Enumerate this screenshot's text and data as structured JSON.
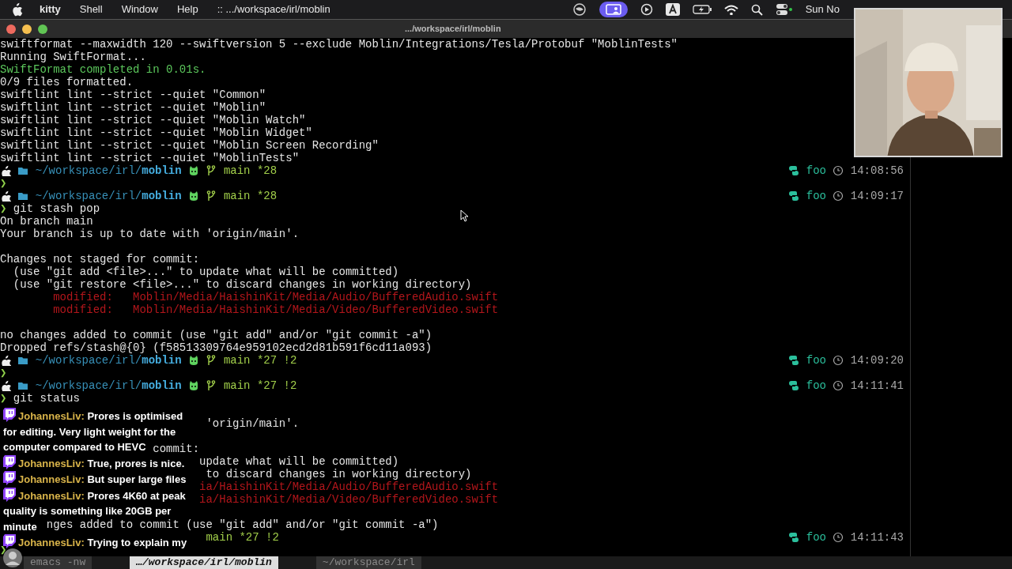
{
  "menu_bar": {
    "app": "kitty",
    "items": [
      "Shell",
      "Window",
      "Help"
    ],
    "window_label": ":: .../workspace/irl/moblin",
    "clock": "Sun No"
  },
  "window": {
    "title": ".../workspace/irl/moblin"
  },
  "terminal_lines": [
    {
      "kind": "output",
      "text": "swiftformat --maxwidth 120 --swiftversion 5 --exclude Moblin/Integrations/Tesla/Protobuf \"MoblinTests\""
    },
    {
      "kind": "output",
      "text": "Running SwiftFormat..."
    },
    {
      "kind": "success_output",
      "text": "SwiftFormat completed in 0.01s."
    },
    {
      "kind": "output",
      "text": "0/9 files formatted."
    },
    {
      "kind": "output",
      "text": "swiftlint lint --strict --quiet \"Common\""
    },
    {
      "kind": "output",
      "text": "swiftlint lint --strict --quiet \"Moblin\""
    },
    {
      "kind": "output",
      "text": "swiftlint lint --strict --quiet \"Moblin Watch\""
    },
    {
      "kind": "output",
      "text": "swiftlint lint --strict --quiet \"Moblin Widget\""
    },
    {
      "kind": "output",
      "text": "swiftlint lint --strict --quiet \"Moblin Screen Recording\""
    },
    {
      "kind": "output",
      "text": "swiftlint lint --strict --quiet \"MoblinTests\""
    },
    {
      "kind": "prompt",
      "path": "~/workspace/irl/",
      "dir": "moblin",
      "branch": "main *28",
      "env": "foo",
      "time": "14:08:56"
    },
    {
      "kind": "input",
      "symbol": "❯"
    },
    {
      "kind": "prompt",
      "path": "~/workspace/irl/",
      "dir": "moblin",
      "branch": "main *28",
      "env": "foo",
      "time": "14:09:17"
    },
    {
      "kind": "input",
      "symbol": "❯",
      "command": "git stash pop"
    },
    {
      "kind": "output",
      "text": "On branch main"
    },
    {
      "kind": "output",
      "text": "Your branch is up to date with 'origin/main'."
    },
    {
      "kind": "blank"
    },
    {
      "kind": "output",
      "text": "Changes not staged for commit:"
    },
    {
      "kind": "output",
      "text": "  (use \"git add <file>...\" to update what will be committed)"
    },
    {
      "kind": "output",
      "text": "  (use \"git restore <file>...\" to discard changes in working directory)"
    },
    {
      "kind": "error_output",
      "text": "        modified:   Moblin/Media/HaishinKit/Media/Audio/BufferedAudio.swift"
    },
    {
      "kind": "error_output",
      "text": "        modified:   Moblin/Media/HaishinKit/Media/Video/BufferedVideo.swift"
    },
    {
      "kind": "blank"
    },
    {
      "kind": "output",
      "text": "no changes added to commit (use \"git add\" and/or \"git commit -a\")"
    },
    {
      "kind": "output",
      "text": "Dropped refs/stash@{0} (f58513309764e959102ecd2d81b591f6cd11a093)"
    },
    {
      "kind": "prompt",
      "path": "~/workspace/irl/",
      "dir": "moblin",
      "branch": "main *27 !2",
      "env": "foo",
      "time": "14:09:20"
    },
    {
      "kind": "input",
      "symbol": "❯"
    },
    {
      "kind": "prompt",
      "path": "~/workspace/irl/",
      "dir": "moblin",
      "branch": "main *27 !2",
      "env": "foo",
      "time": "14:11:41"
    },
    {
      "kind": "input",
      "symbol": "❯",
      "command": "git status"
    },
    {
      "kind": "blank"
    },
    {
      "kind": "output",
      "text": "                               'origin/main'."
    },
    {
      "kind": "blank"
    },
    {
      "kind": "output",
      "text": "                       commit:"
    },
    {
      "kind": "output",
      "text": "                              update what will be committed)"
    },
    {
      "kind": "output",
      "text": "                               to discard changes in working directory)"
    },
    {
      "kind": "error_output",
      "text": "                              ia/HaishinKit/Media/Audio/BufferedAudio.swift"
    },
    {
      "kind": "error_output",
      "text": "                              ia/HaishinKit/Media/Video/BufferedVideo.swift"
    },
    {
      "kind": "blank"
    },
    {
      "kind": "output",
      "text": "       nges added to commit (use \"git add\" and/or \"git commit -a\")"
    },
    {
      "kind": "prompt",
      "branch": "main *27 !2",
      "env": "foo",
      "time": "14:11:43"
    },
    {
      "kind": "input",
      "symbol": "❯"
    }
  ],
  "chat": [
    {
      "user": "JohannesLiv:",
      "lines": [
        "Prores is optimised",
        "for editing. Very light weight for the",
        "computer compared to HEVC"
      ]
    },
    {
      "user": "JohannesLiv:",
      "lines": [
        "True, prores is nice."
      ]
    },
    {
      "user": "JohannesLiv:",
      "lines": [
        "But super large files"
      ]
    },
    {
      "user": "JohannesLiv:",
      "lines": [
        "Prores 4K60 at peak",
        "quality is something like 20GB per",
        "minute"
      ]
    },
    {
      "user": "JohannesLiv:",
      "lines": [
        "Trying to explain my"
      ]
    }
  ],
  "tabs": [
    {
      "label": "emacs -nw",
      "selected": false
    },
    {
      "label": "…/workspace/irl/moblin",
      "selected": true
    },
    {
      "label": "~/workspace/irl",
      "selected": false
    }
  ]
}
